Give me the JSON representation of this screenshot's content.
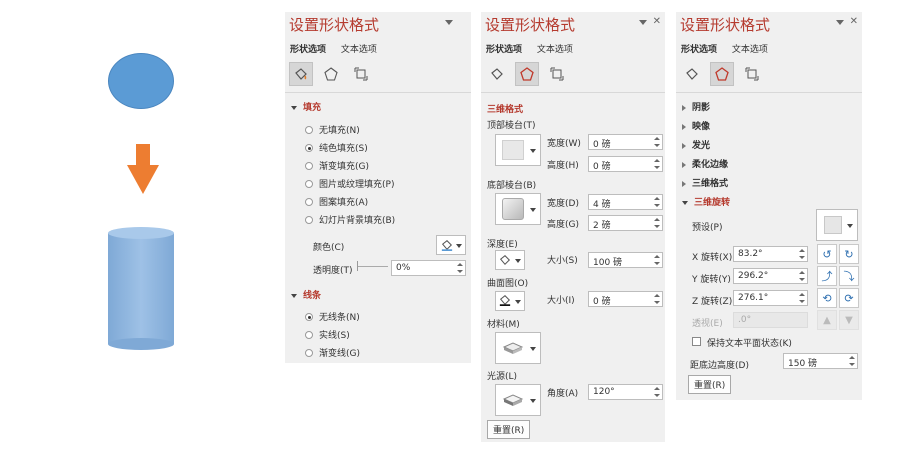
{
  "panel_title": "设置形状格式",
  "tabs": {
    "shape": "形状选项",
    "text": "文本选项"
  },
  "panel1": {
    "fill_section": "填充",
    "fill_options": [
      "无填充(N)",
      "纯色填充(S)",
      "渐变填充(G)",
      "图片或纹理填充(P)",
      "图案填充(A)",
      "幻灯片背景填充(B)"
    ],
    "color_label": "颜色(C)",
    "transparency_label": "透明度(T)",
    "transparency_value": "0%",
    "line_section": "线条",
    "line_options": [
      "无线条(N)",
      "实线(S)",
      "渐变线(G)"
    ]
  },
  "panel2": {
    "section": "三维格式",
    "top_bevel": "顶部棱台(T)",
    "width_t_label": "宽度(W)",
    "width_t_value": "0 磅",
    "height_t_label": "高度(H)",
    "height_t_value": "0 磅",
    "bottom_bevel": "底部棱台(B)",
    "width_b_label": "宽度(D)",
    "width_b_value": "4 磅",
    "height_b_label": "高度(G)",
    "height_b_value": "2 磅",
    "depth_label": "深度(E)",
    "depth_size_label": "大小(S)",
    "depth_size_value": "100 磅",
    "contour_label": "曲面图(O)",
    "contour_size_label": "大小(I)",
    "contour_size_value": "0 磅",
    "material_label": "材料(M)",
    "light_label": "光源(L)",
    "angle_label": "角度(A)",
    "angle_value": "120°",
    "reset": "重置(R)"
  },
  "panel3": {
    "collapsed": [
      "阴影",
      "映像",
      "发光",
      "柔化边缘",
      "三维格式"
    ],
    "section": "三维旋转",
    "preset_label": "预设(P)",
    "x_label": "X 旋转(X)",
    "x_value": "83.2°",
    "y_label": "Y 旋转(Y)",
    "y_value": "296.2°",
    "z_label": "Z 旋转(Z)",
    "z_value": "276.1°",
    "persp_label": "透视(E)",
    "persp_value": ".0°",
    "keep_flat": "保持文本平面状态(K)",
    "dist_label": "距底边高度(D)",
    "dist_value": "150 磅",
    "reset": "重置(R)"
  },
  "colors": {
    "accent": "#b53a2e",
    "circle": "#5b9bd5",
    "arrow": "#ed7d31",
    "cylinder": "#8fb4de"
  }
}
